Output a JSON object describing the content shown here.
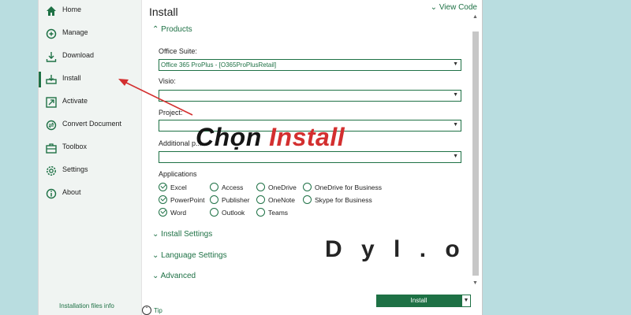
{
  "sidebar": {
    "items": [
      {
        "label": "Home",
        "icon": "home-icon"
      },
      {
        "label": "Manage",
        "icon": "manage-icon"
      },
      {
        "label": "Download",
        "icon": "download-icon"
      },
      {
        "label": "Install",
        "icon": "install-icon",
        "active": true
      },
      {
        "label": "Activate",
        "icon": "activate-icon"
      },
      {
        "label": "Convert Document",
        "icon": "convert-icon"
      },
      {
        "label": "Toolbox",
        "icon": "toolbox-icon"
      },
      {
        "label": "Settings",
        "icon": "gear-icon"
      },
      {
        "label": "About",
        "icon": "info-icon"
      }
    ],
    "footer_link": "Installation files info"
  },
  "main": {
    "title": "Install",
    "view_code": "View Code",
    "products_section": "Products",
    "fields": {
      "office_suite": {
        "label": "Office Suite:",
        "value": "Office 365 ProPlus - [O365ProPlusRetail]"
      },
      "visio": {
        "label": "Visio:",
        "value": ""
      },
      "project": {
        "label": "Project:",
        "value": ""
      },
      "additional": {
        "label": "Additional p...",
        "value": ""
      }
    },
    "applications_label": "Applications",
    "applications": [
      {
        "name": "Excel",
        "checked": true
      },
      {
        "name": "Access",
        "checked": false
      },
      {
        "name": "OneDrive",
        "checked": false
      },
      {
        "name": "OneDrive for Business",
        "checked": false
      },
      {
        "name": "PowerPoint",
        "checked": true
      },
      {
        "name": "Publisher",
        "checked": false
      },
      {
        "name": "OneNote",
        "checked": false
      },
      {
        "name": "Skype for Business",
        "checked": false
      },
      {
        "name": "Word",
        "checked": true
      },
      {
        "name": "Outlook",
        "checked": false
      },
      {
        "name": "Teams",
        "checked": false
      }
    ],
    "collapsed_sections": [
      "Install Settings",
      "Language Settings",
      "Advanced"
    ],
    "install_button": "Install",
    "tip": "Tip"
  },
  "overlay": {
    "prefix": "Chọn ",
    "highlight": "Install",
    "watermark": "D y l . o"
  },
  "colors": {
    "accent": "#1e7145",
    "background": "#b9dde0",
    "arrow": "#d32f2f"
  }
}
